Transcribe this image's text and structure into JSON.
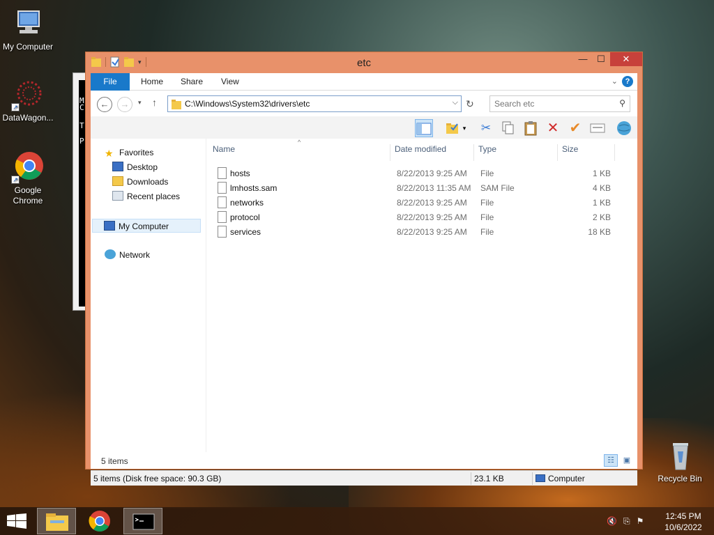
{
  "desktop": {
    "icons": [
      {
        "label": "My Computer"
      },
      {
        "label": "DataWagon..."
      },
      {
        "label": "Google Chrome"
      },
      {
        "label": "Recycle Bin"
      }
    ],
    "console_letters": [
      "M",
      "C",
      "T",
      "P"
    ]
  },
  "window": {
    "title": "etc",
    "controls": {
      "minimize": "—",
      "maximize": "☐",
      "close": "✕"
    },
    "ribbon": {
      "tabs": [
        "File",
        "Home",
        "Share",
        "View"
      ],
      "help": "?"
    },
    "address": {
      "path": "C:\\Windows\\System32\\drivers\\etc"
    },
    "search": {
      "placeholder": "Search etc"
    },
    "nav_pane": {
      "favorites": "Favorites",
      "items": [
        "Desktop",
        "Downloads",
        "Recent places"
      ],
      "computer": "My Computer",
      "network": "Network"
    },
    "columns": [
      "Name",
      "Date modified",
      "Type",
      "Size"
    ],
    "files": [
      {
        "name": "hosts",
        "date": "8/22/2013 9:25 AM",
        "type": "File",
        "size": "1 KB"
      },
      {
        "name": "lmhosts.sam",
        "date": "8/22/2013 11:35 AM",
        "type": "SAM File",
        "size": "4 KB"
      },
      {
        "name": "networks",
        "date": "8/22/2013 9:25 AM",
        "type": "File",
        "size": "1 KB"
      },
      {
        "name": "protocol",
        "date": "8/22/2013 9:25 AM",
        "type": "File",
        "size": "2 KB"
      },
      {
        "name": "services",
        "date": "8/22/2013 9:25 AM",
        "type": "File",
        "size": "18 KB"
      }
    ],
    "item_count": "5 items",
    "statusbar": {
      "summary": "5 items (Disk free space: 90.3 GB)",
      "size": "23.1 KB",
      "location": "Computer"
    }
  },
  "taskbar": {
    "time": "12:45 PM",
    "date": "10/6/2022"
  },
  "colors": {
    "window_frame": "#e8916a",
    "file_tab": "#1979ca",
    "close_button": "#c7413b"
  }
}
